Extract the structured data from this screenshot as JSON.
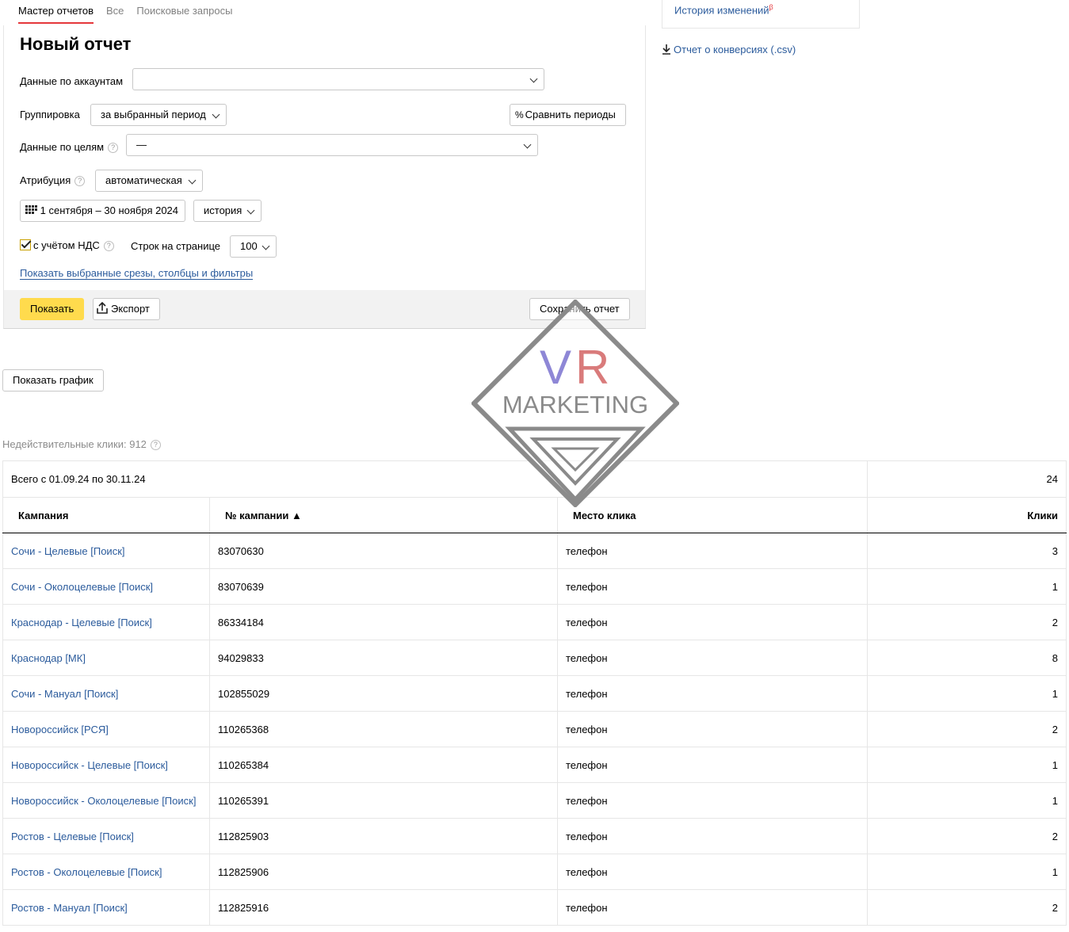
{
  "tabs": [
    "Мастер отчетов",
    "Все",
    "Поисковые запросы"
  ],
  "report": {
    "title": "Новый отчет",
    "accounts_label": "Данные по аккаунтам",
    "accounts_value": "",
    "grouping_label": "Группировка",
    "grouping_value": "за выбранный период",
    "compare_label": "Сравнить периоды",
    "goals_label": "Данные по целям",
    "goals_value": "—",
    "attribution_label": "Атрибуция",
    "attribution_value": "автоматическая",
    "date_range": "1 сентября – 30 ноября 2024",
    "history_value": "история",
    "vat_label": "с учётом НДС",
    "rows_label": "Строк на странице",
    "rows_value": "100",
    "show_filters_link": "Показать выбранные срезы, столбцы и фильтры",
    "show_button": "Показать",
    "export_button": "Экспорт",
    "save_button": "Сохранить отчет"
  },
  "side": {
    "history_link": "История изменений",
    "history_badge": "β",
    "csv_link": "Отчет о конверсиях (.csv)"
  },
  "chart_button": "Показать график",
  "invalid_clicks": "Недействительные клики: 912",
  "watermark": {
    "line1": "VR",
    "line2": "MARKETING"
  },
  "table": {
    "total_label": "Всего с 01.09.24 по 30.11.24",
    "total_value": "24",
    "headers": {
      "campaign": "Кампания",
      "campaign_id": "№ кампании ▲",
      "place": "Место клика",
      "clicks": "Клики"
    },
    "rows": [
      {
        "campaign": "Сочи - Целевые [Поиск]",
        "id": "83070630",
        "place": "телефон",
        "clicks": "3"
      },
      {
        "campaign": "Сочи - Околоцелевые [Поиск]",
        "id": "83070639",
        "place": "телефон",
        "clicks": "1"
      },
      {
        "campaign": "Краснодар - Целевые [Поиск]",
        "id": "86334184",
        "place": "телефон",
        "clicks": "2"
      },
      {
        "campaign": "Краснодар [МК]",
        "id": "94029833",
        "place": "телефон",
        "clicks": "8"
      },
      {
        "campaign": "Сочи - Мануал [Поиск]",
        "id": "102855029",
        "place": "телефон",
        "clicks": "1"
      },
      {
        "campaign": "Новороссийск [РСЯ]",
        "id": "110265368",
        "place": "телефон",
        "clicks": "2"
      },
      {
        "campaign": "Новороссийск - Целевые [Поиск]",
        "id": "110265384",
        "place": "телефон",
        "clicks": "1"
      },
      {
        "campaign": "Новороссийск - Околоцелевые [Поиск]",
        "id": "110265391",
        "place": "телефон",
        "clicks": "1"
      },
      {
        "campaign": "Ростов - Целевые [Поиск]",
        "id": "112825903",
        "place": "телефон",
        "clicks": "2"
      },
      {
        "campaign": "Ростов - Околоцелевые [Поиск]",
        "id": "112825906",
        "place": "телефон",
        "clicks": "1"
      },
      {
        "campaign": "Ростов - Мануал [Поиск]",
        "id": "112825916",
        "place": "телефон",
        "clicks": "2"
      }
    ]
  },
  "colors": {
    "link": "#2b5b9c",
    "accent": "#ffdb4d",
    "tab_underline": "#e5373b"
  }
}
